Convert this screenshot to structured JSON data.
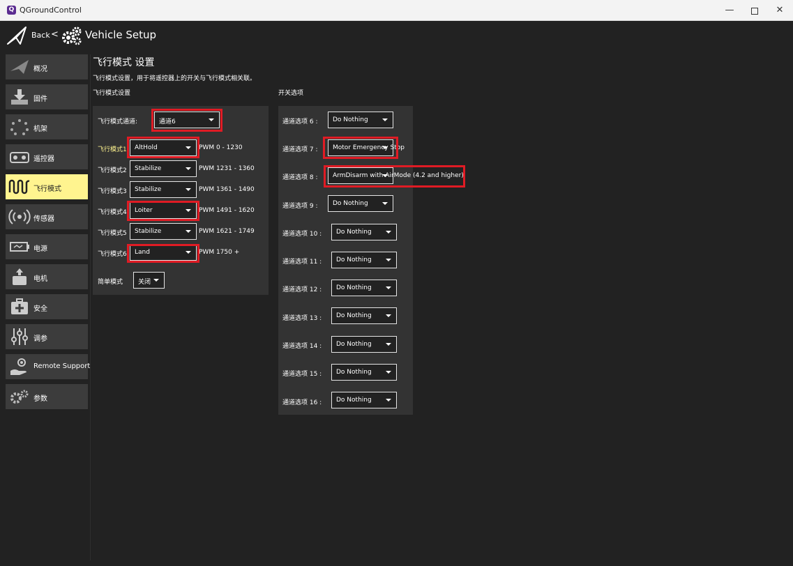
{
  "window": {
    "title": "QGroundControl",
    "app_icon_letter": "Q"
  },
  "toolbar": {
    "back_label": "Back",
    "back_sep": "<",
    "title": "Vehicle Setup"
  },
  "sidebar": {
    "items": [
      {
        "label": "概况",
        "icon": "paper-plane-icon"
      },
      {
        "label": "固件",
        "icon": "download-icon"
      },
      {
        "label": "机架",
        "icon": "airframe-icon"
      },
      {
        "label": "遥控器",
        "icon": "radio-icon"
      },
      {
        "label": "飞行模式",
        "icon": "flight-modes-icon",
        "active": true
      },
      {
        "label": "传感器",
        "icon": "sensors-icon"
      },
      {
        "label": "电源",
        "icon": "battery-icon"
      },
      {
        "label": "电机",
        "icon": "motor-icon"
      },
      {
        "label": "安全",
        "icon": "safety-icon"
      },
      {
        "label": "调参",
        "icon": "tuning-icon"
      },
      {
        "label": "Remote Support",
        "icon": "remote-support-icon"
      },
      {
        "label": "参数",
        "icon": "gears-icon"
      }
    ]
  },
  "main": {
    "title": "飞行模式 设置",
    "description": "飞行模式设置，用于将遥控器上的开关与飞行模式相关联。",
    "left_section_title": "飞行模式设置",
    "right_section_title": "开关选项",
    "channel_label": "飞行模式通道:",
    "channel_value": "通道6",
    "flight_modes": [
      {
        "label": "飞行模式1",
        "value": "AltHold",
        "pwm": "PWM 0 - 1230"
      },
      {
        "label": "飞行模式2",
        "value": "Stabilize",
        "pwm": "PWM 1231 - 1360"
      },
      {
        "label": "飞行模式3",
        "value": "Stabilize",
        "pwm": "PWM 1361 - 1490"
      },
      {
        "label": "飞行模式4",
        "value": "Loiter",
        "pwm": "PWM 1491 - 1620"
      },
      {
        "label": "飞行模式5",
        "value": "Stabilize",
        "pwm": "PWM 1621 - 1749"
      },
      {
        "label": "飞行模式6",
        "value": "Land",
        "pwm": "PWM 1750 +"
      }
    ],
    "simple_mode_label": "简单模式",
    "simple_mode_value": "关闭",
    "channel_options": [
      {
        "label": "通道选项 6 :",
        "value": "Do Nothing"
      },
      {
        "label": "通道选项 7 :",
        "value": "Motor Emergency Stop"
      },
      {
        "label": "通道选项 8 :",
        "value": "ArmDisarm with AirMode  (4.2 and higher)"
      },
      {
        "label": "通道选项 9 :",
        "value": "Do Nothing"
      },
      {
        "label": "通道选项 10 :",
        "value": "Do Nothing"
      },
      {
        "label": "通道选项 11 :",
        "value": "Do Nothing"
      },
      {
        "label": "通道选项 12 :",
        "value": "Do Nothing"
      },
      {
        "label": "通道选项 13 :",
        "value": "Do Nothing"
      },
      {
        "label": "通道选项 14 :",
        "value": "Do Nothing"
      },
      {
        "label": "通道选项 15 :",
        "value": "Do Nothing"
      },
      {
        "label": "通道选项 16 :",
        "value": "Do Nothing"
      }
    ]
  },
  "colors": {
    "background": "#222222",
    "panel": "#333333",
    "sidebar_button": "#3c3c3c",
    "active_button": "#fff48f",
    "highlight_box": "#e01b24"
  }
}
